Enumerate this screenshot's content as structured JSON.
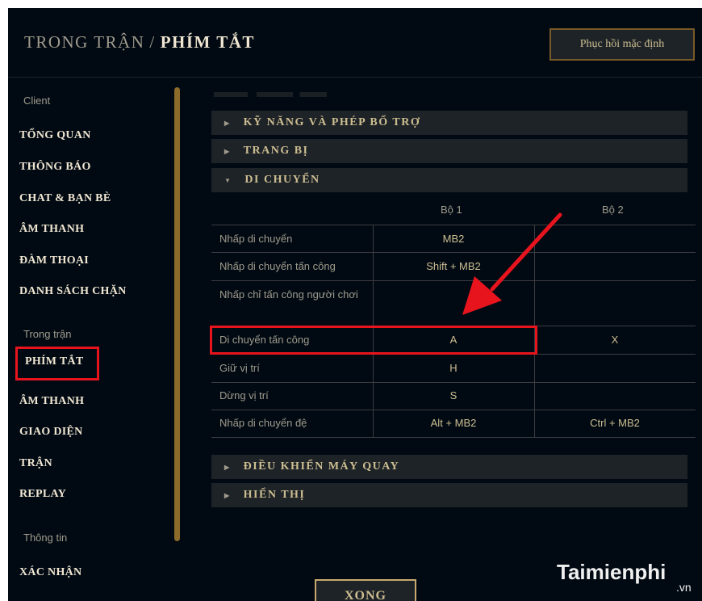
{
  "header": {
    "crumb": "TRONG TRẬN",
    "separator": "/",
    "current": "PHÍM TẮT",
    "reset_label": "Phục hồi mặc định"
  },
  "sidebar": {
    "groups": [
      {
        "label": "Client",
        "items": [
          "TỔNG QUAN",
          "THÔNG BÁO",
          "CHAT & BẠN BÈ",
          "ÂM THANH",
          "ĐÀM THOẠI",
          "DANH SÁCH CHẶN"
        ]
      },
      {
        "label": "Trong trận",
        "items": [
          "PHÍM TẮT",
          "ÂM THANH",
          "GIAO DIỆN",
          "TRẬN",
          "REPLAY"
        ]
      },
      {
        "label": "Thông tin",
        "items": [
          "XÁC NHẬN"
        ]
      }
    ],
    "active_item": "PHÍM TẮT"
  },
  "sections_top": [
    "KỸ NĂNG VÀ PHÉP BỔ TRỢ",
    "TRANG BỊ",
    "DI CHUYỂN"
  ],
  "sections_bottom": [
    "ĐIỀU KHIỂN MÁY QUAY",
    "HIỂN THỊ"
  ],
  "table": {
    "columns": [
      "Bộ 1",
      "Bộ 2"
    ],
    "rows": [
      {
        "label": "Nhấp di chuyển",
        "set1": "MB2",
        "set2": ""
      },
      {
        "label": "Nhấp di chuyển tấn công",
        "set1": "Shift + MB2",
        "set2": ""
      },
      {
        "label": "Nhấp chỉ tấn công người chơi",
        "set1": "",
        "set2": ""
      },
      {
        "label": "Di chuyển tấn công",
        "set1": "A",
        "set2": "X"
      },
      {
        "label": "Giữ vị trí",
        "set1": "H",
        "set2": ""
      },
      {
        "label": "Dừng vị trí",
        "set1": "S",
        "set2": ""
      },
      {
        "label": "Nhấp di chuyển đệ",
        "set1": "Alt + MB2",
        "set2": "Ctrl + MB2"
      }
    ]
  },
  "footer": {
    "done_label": "XONG"
  },
  "watermark": {
    "brand": "Taimienphi",
    "suffix": ".vn"
  },
  "colors": {
    "background": "#010a13",
    "gold": "#c8aa6e",
    "highlight": "#e7141d"
  }
}
